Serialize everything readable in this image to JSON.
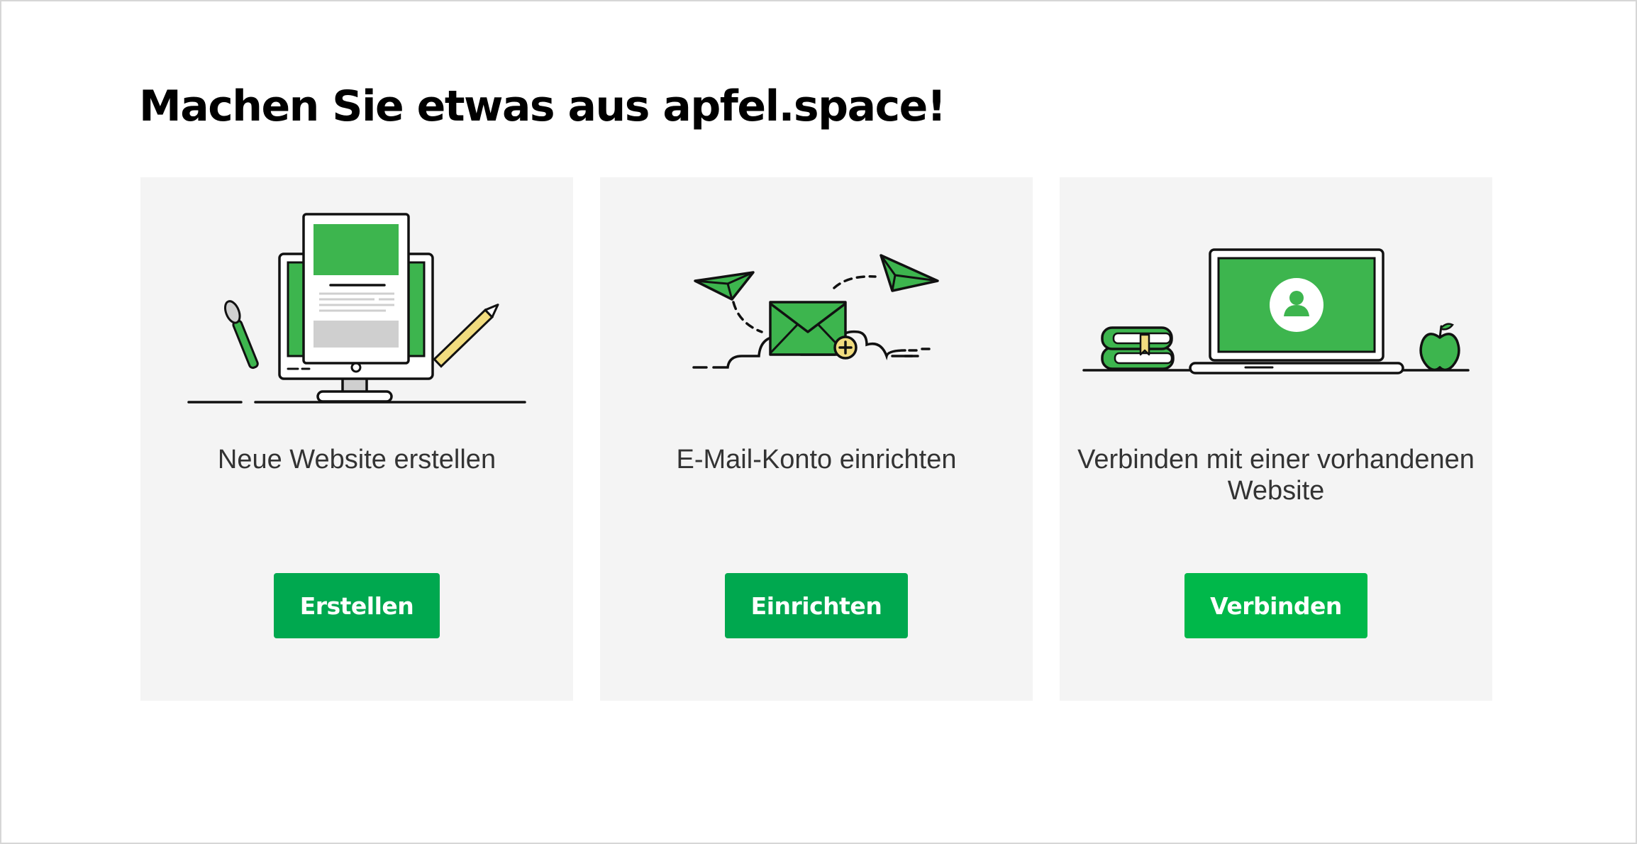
{
  "page": {
    "title": "Machen Sie etwas aus apfel.space!"
  },
  "colors": {
    "accent": "#00a84f",
    "accent_bright": "#00b84a",
    "illustration_green": "#3db54e",
    "card_bg": "#f4f4f4"
  },
  "cards": [
    {
      "illustration": "monitor-website-icon",
      "label": "Neue Website erstellen",
      "button_label": "Erstellen"
    },
    {
      "illustration": "envelope-paper-planes-icon",
      "label": "E-Mail-Konto einrichten",
      "button_label": "Einrichten"
    },
    {
      "illustration": "laptop-user-icon",
      "label": "Verbinden mit einer vorhandenen Website",
      "button_label": "Verbinden"
    }
  ]
}
